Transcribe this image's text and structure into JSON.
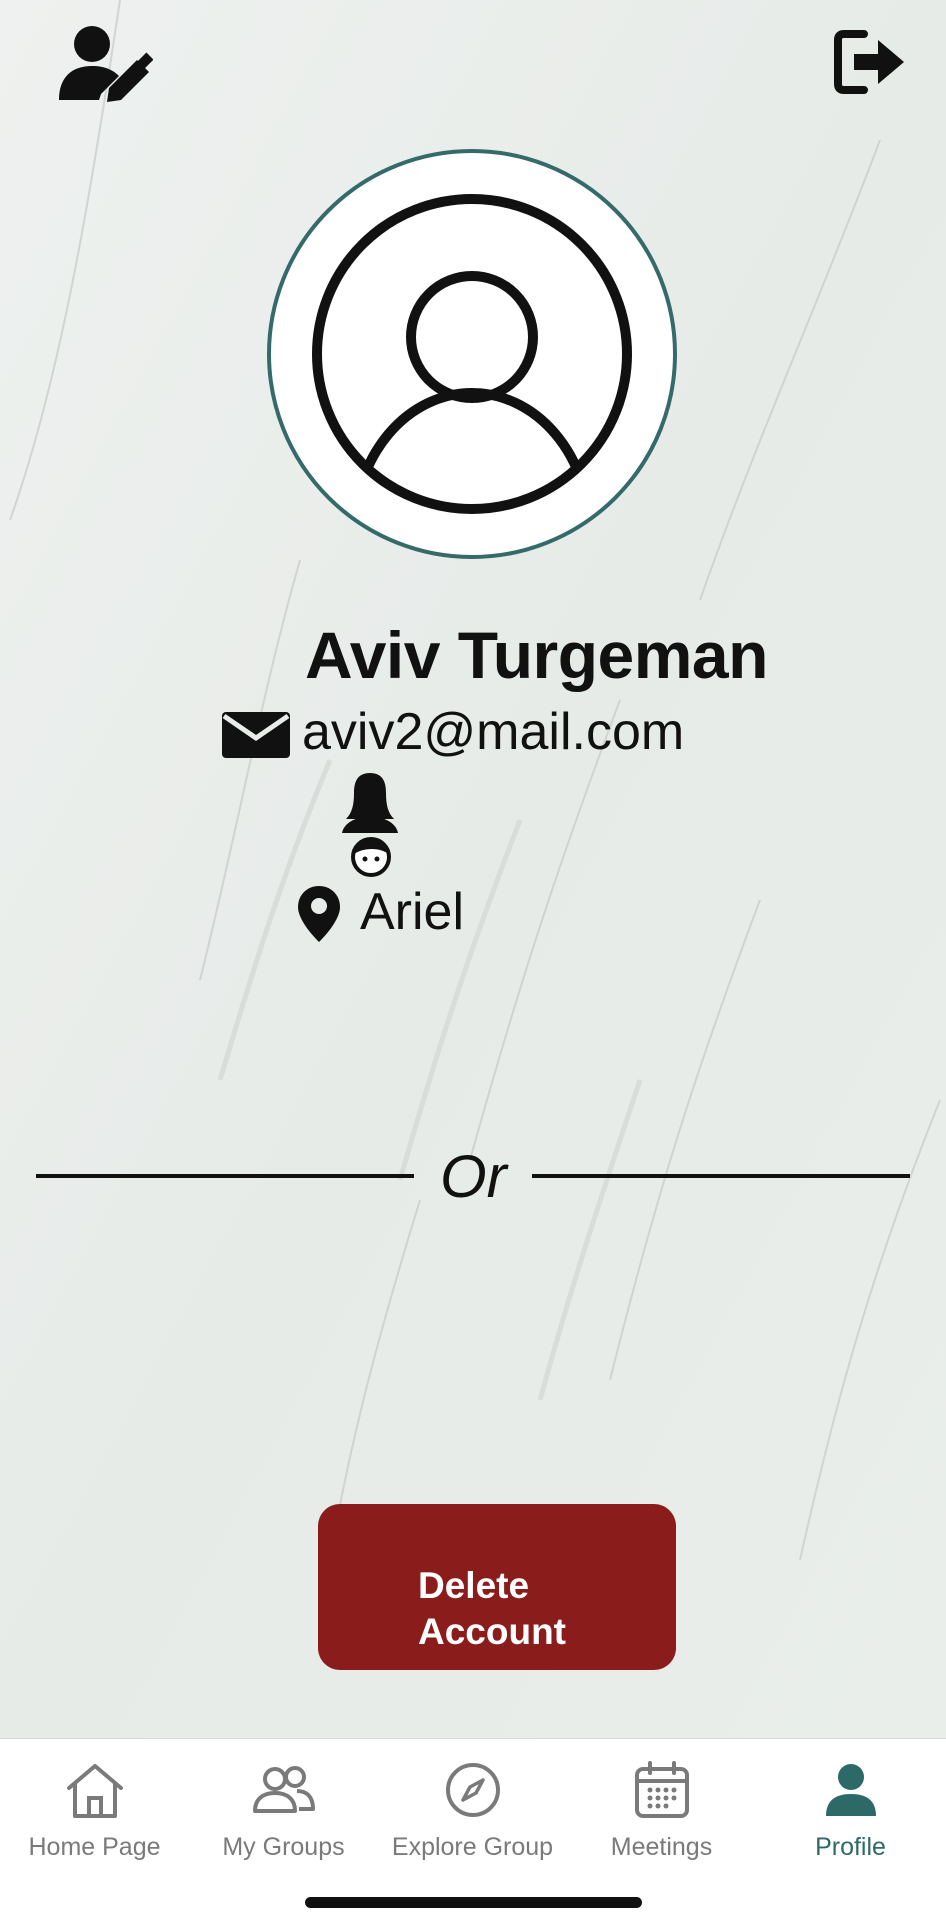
{
  "header": {
    "edit_profile_icon": "user-edit-icon",
    "logout_icon": "sign-out-icon"
  },
  "profile": {
    "avatar_icon": "user-avatar-placeholder",
    "name": "Aviv Turgeman",
    "email": "aviv2@mail.com",
    "email_icon": "envelope-icon",
    "gender_icon": "female-user-icon",
    "city": "Ariel",
    "city_icon": "map-marker-icon"
  },
  "divider": {
    "text": "Or"
  },
  "actions": {
    "delete_label_line1": "Delete",
    "delete_label_line2": "Account",
    "delete_color": "#8b1c1c"
  },
  "tabs": [
    {
      "label": "Home Page",
      "icon": "home-icon",
      "active": false
    },
    {
      "label": "My Groups",
      "icon": "groups-icon",
      "active": false
    },
    {
      "label": "Explore Group",
      "icon": "compass-icon",
      "active": false
    },
    {
      "label": "Meetings",
      "icon": "calendar-icon",
      "active": false
    },
    {
      "label": "Profile",
      "icon": "person-icon",
      "active": true
    }
  ],
  "colors": {
    "accent": "#2d6a67",
    "avatar_border": "#356a6a",
    "inactive_tab": "#7a7a7a"
  }
}
